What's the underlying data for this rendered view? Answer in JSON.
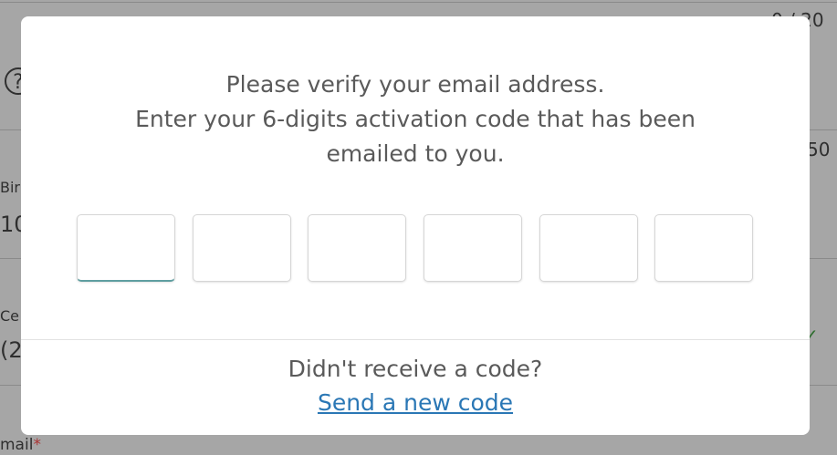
{
  "background": {
    "counter_top": "0 / 20",
    "counter_mid": "50",
    "help_glyph": "?",
    "field1_label": "Bir",
    "field1_value": "10",
    "field2_label": "Ce",
    "field2_value": "(2",
    "field3_label": "mail",
    "required_mark": "*",
    "check_icon": "check-icon"
  },
  "modal": {
    "message_line1": "Please verify your email address.",
    "message_line2": "Enter your 6-digits activation code that has been",
    "message_line3": "emailed to you.",
    "code_length": 6,
    "code_digits": [
      "",
      "",
      "",
      "",
      "",
      ""
    ],
    "active_digit": 1,
    "active_color": "#5f9ea0",
    "footer_question": "Didn't receive a code?",
    "resend_link": "Send a new code",
    "link_color": "#2a77b5"
  }
}
